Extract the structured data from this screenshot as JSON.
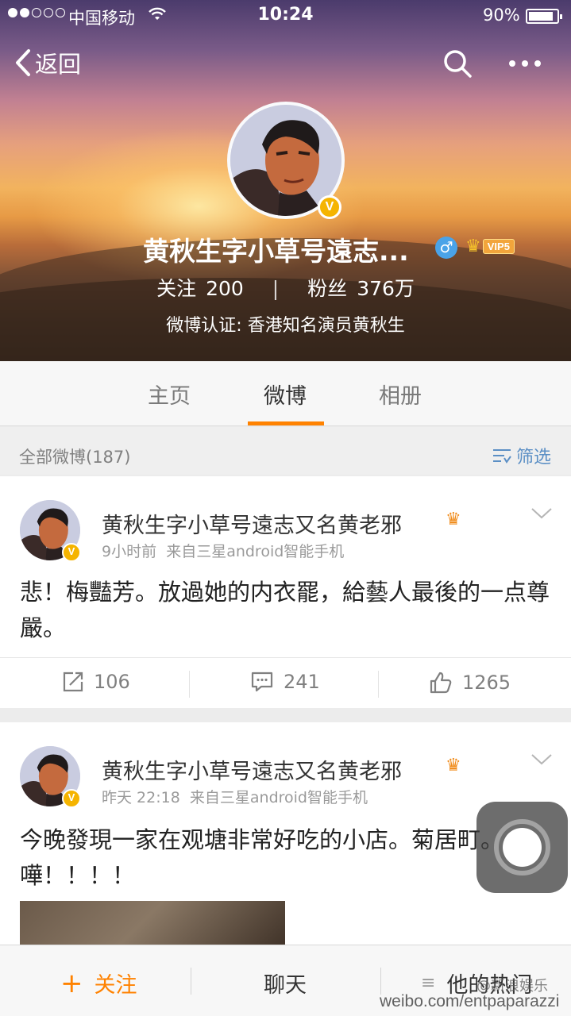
{
  "status_bar": {
    "carrier": "中国移动",
    "time": "10:24",
    "battery": "90%",
    "signal_bars_filled": 2,
    "signal_bars_total": 5
  },
  "nav": {
    "back_label": "返回",
    "search_icon": "search-icon",
    "more_icon": "more-icon"
  },
  "profile": {
    "name": "黄秋生字小草号遠志...",
    "verified_badge": "V",
    "gender_symbol": "♂",
    "vip_label": "VIP5",
    "following_label": "关注",
    "following_count": "200",
    "followers_label": "粉丝",
    "followers_count": "376万",
    "verification": "微博认证: 香港知名演员黄秋生"
  },
  "tabs": [
    {
      "label": "主页",
      "active": false
    },
    {
      "label": "微博",
      "active": true
    },
    {
      "label": "相册",
      "active": false
    }
  ],
  "filter": {
    "count_label": "全部微博(187)",
    "filter_label": "筛选"
  },
  "posts": [
    {
      "author": "黄秋生字小草号遠志又名黄老邪",
      "time": "9小时前",
      "source": "来自三星android智能手机",
      "text": "悲！梅豔芳。放過她的内衣罷，給藝人最後的一点尊嚴。",
      "reposts": "106",
      "comments": "241",
      "likes": "1265"
    },
    {
      "author": "黄秋生字小草号遠志又名黄老邪",
      "time": "昨天 22:18",
      "source": "来自三星android智能手机",
      "text": "今晚發現一家在观塘非常好吃的小店。菊居町。嘩！！！！"
    }
  ],
  "bottom_bar": {
    "follow_label": "关注",
    "chat_label": "聊天",
    "hot_label": "他的热门"
  },
  "watermark": {
    "line1": "@新浪娱乐",
    "line2": "weibo.com/entpaparazzi"
  },
  "colors": {
    "accent": "#ff8200",
    "link_blue": "#5b8fc5",
    "verified_gold": "#f5b400"
  }
}
